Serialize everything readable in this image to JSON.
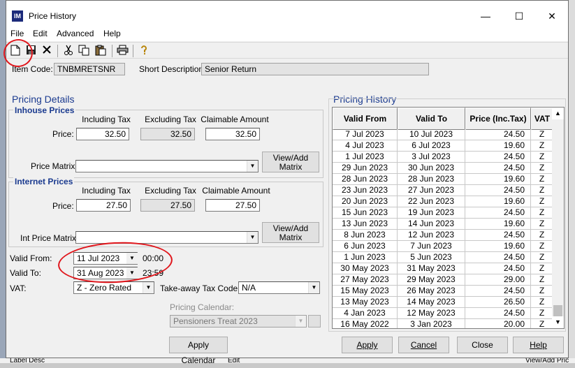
{
  "window": {
    "title": "Price History",
    "minimize_glyph": "—",
    "maximize_glyph": "☐",
    "close_glyph": "✕",
    "app_icon_text": "IM"
  },
  "menu": [
    "File",
    "Edit",
    "Advanced",
    "Help"
  ],
  "toolbar_icons": [
    "new-document-icon",
    "save-icon",
    "delete-icon",
    "cut-icon",
    "copy-icon",
    "paste-icon",
    "print-icon",
    "help-icon"
  ],
  "item": {
    "code_label": "Item Code:",
    "code_value": "TNBMRETSNR",
    "desc_label": "Short Description:",
    "desc_value": "Senior Return"
  },
  "pricing_details": {
    "title": "Pricing Details",
    "inhouse": {
      "title": "Inhouse Prices",
      "col_incl": "Including Tax",
      "col_excl": "Excluding Tax",
      "col_claim": "Claimable Amount",
      "price_label": "Price:",
      "incl": "32.50",
      "excl": "32.50",
      "claim": "32.50",
      "matrix_label": "Price Matrix:",
      "matrix_btn_line1": "View/Add",
      "matrix_btn_line2": "Matrix"
    },
    "internet": {
      "title": "Internet Prices",
      "col_incl": "Including Tax",
      "col_excl": "Excluding Tax",
      "col_claim": "Claimable Amount",
      "price_label": "Price:",
      "incl": "27.50",
      "excl": "27.50",
      "claim": "27.50",
      "matrix_label": "Int Price Matrix:",
      "matrix_btn_line1": "View/Add",
      "matrix_btn_line2": "Matrix"
    },
    "valid_from_label": "Valid From:",
    "valid_from_date": "11  Jul  2023",
    "valid_from_time": "00:00",
    "valid_to_label": "Valid To:",
    "valid_to_date": "31 Aug 2023",
    "valid_to_time": "23:59",
    "vat_label": "VAT:",
    "vat_value": "Z - Zero Rated",
    "takeaway_label": "Take-away Tax Code:",
    "takeaway_value": "N/A",
    "calendar_label": "Pricing Calendar:",
    "calendar_value": "Pensioners Treat 2023",
    "apply_calendar_btn": "Apply Calendar"
  },
  "pricing_history": {
    "title": "Pricing History",
    "columns": [
      "Valid From",
      "Valid To",
      "Price (Inc.Tax)",
      "VAT"
    ],
    "rows": [
      [
        "7 Jul 2023",
        "10 Jul 2023",
        "24.50",
        "Z"
      ],
      [
        "4 Jul 2023",
        "6 Jul 2023",
        "19.60",
        "Z"
      ],
      [
        "1 Jul 2023",
        "3 Jul 2023",
        "24.50",
        "Z"
      ],
      [
        "29 Jun 2023",
        "30 Jun 2023",
        "24.50",
        "Z"
      ],
      [
        "28 Jun 2023",
        "28 Jun 2023",
        "19.60",
        "Z"
      ],
      [
        "23 Jun 2023",
        "27 Jun 2023",
        "24.50",
        "Z"
      ],
      [
        "20 Jun 2023",
        "22 Jun 2023",
        "19.60",
        "Z"
      ],
      [
        "15 Jun 2023",
        "19 Jun 2023",
        "24.50",
        "Z"
      ],
      [
        "13 Jun 2023",
        "14 Jun 2023",
        "19.60",
        "Z"
      ],
      [
        "8 Jun 2023",
        "12 Jun 2023",
        "24.50",
        "Z"
      ],
      [
        "6 Jun 2023",
        "7 Jun 2023",
        "19.60",
        "Z"
      ],
      [
        "1 Jun 2023",
        "5 Jun 2023",
        "24.50",
        "Z"
      ],
      [
        "30 May 2023",
        "31 May 2023",
        "24.50",
        "Z"
      ],
      [
        "27 May 2023",
        "29 May 2023",
        "29.00",
        "Z"
      ],
      [
        "15 May 2023",
        "26 May 2023",
        "24.50",
        "Z"
      ],
      [
        "13 May 2023",
        "14 May 2023",
        "26.50",
        "Z"
      ],
      [
        "4 Jan 2023",
        "12 May 2023",
        "24.50",
        "Z"
      ],
      [
        "16 May 2022",
        "3 Jan 2023",
        "20.00",
        "Z"
      ]
    ]
  },
  "buttons": {
    "apply": "Apply",
    "cancel": "Cancel",
    "close": "Close",
    "help": "Help"
  },
  "background": {
    "bottom_left_text": "Label Desc",
    "bottom_mid_text": "Edit",
    "bottom_right_text": "View/Add Pric"
  },
  "colors": {
    "accent": "#1a3a8f",
    "annotation": "#e0161c"
  }
}
